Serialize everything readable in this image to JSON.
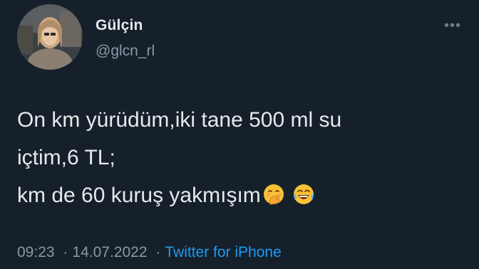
{
  "author": {
    "display_name": "Gülçin",
    "handle": "@glcn_rl",
    "avatar_icon": "profile-photo"
  },
  "menu": {
    "icon": "more-icon",
    "glyph": "•••"
  },
  "tweet": {
    "lines": [
      "On km yürüdüm,iki tane 500 ml su",
      "içtim,6 TL;",
      "km de 60 kuruş yakmışım"
    ],
    "emojis": [
      "hand-over-mouth-emoji-icon",
      "tears-of-joy-emoji-icon"
    ]
  },
  "meta": {
    "time": "09:23",
    "separator": "·",
    "date": "14.07.2022",
    "source": "Twitter for iPhone"
  },
  "colors": {
    "background": "#15202b",
    "primary_text": "#e7e9ea",
    "secondary_text": "#8b98a5",
    "link": "#1d9bf0"
  }
}
